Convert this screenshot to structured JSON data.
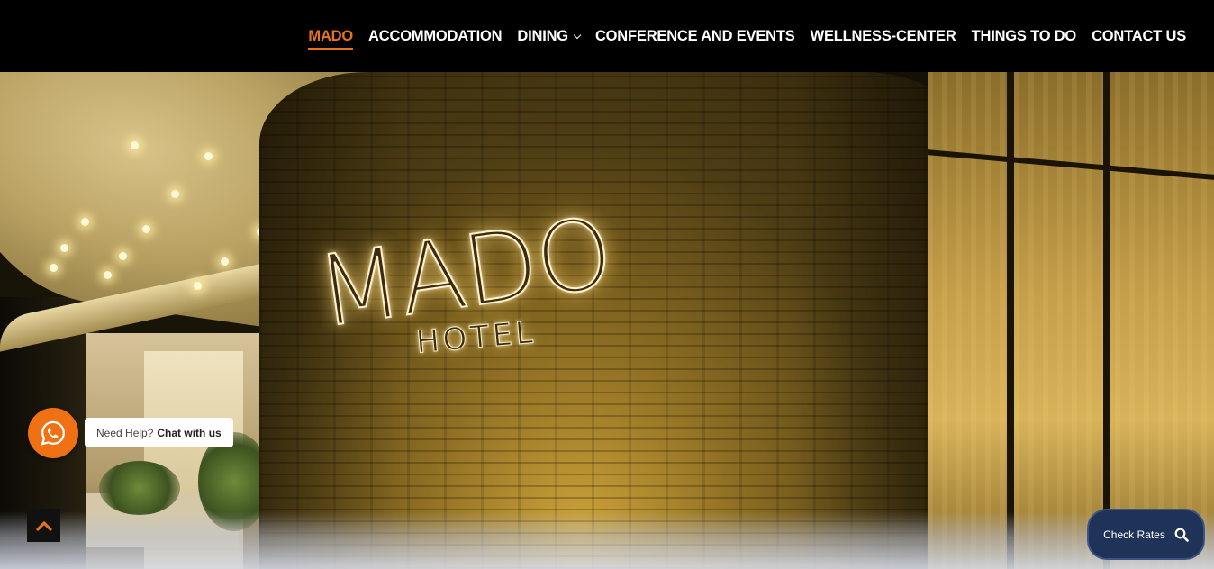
{
  "nav": {
    "items": [
      {
        "label": "MADO",
        "active": true
      },
      {
        "label": "ACCOMMODATION"
      },
      {
        "label": "DINING",
        "dropdown": true
      },
      {
        "label": "CONFERENCE AND EVENTS"
      },
      {
        "label": "WELLNESS-CENTER"
      },
      {
        "label": "THINGS TO DO"
      },
      {
        "label": "CONTACT US"
      }
    ]
  },
  "hero": {
    "sign_main": "MADO",
    "sign_sub": "HOTEL"
  },
  "chat": {
    "prefix": "Need Help?",
    "link": "Chat with us",
    "icon": "whatsapp-icon"
  },
  "back_to_top": {
    "icon": "chevron-up-icon"
  },
  "check_rates": {
    "label": "Check Rates",
    "icon": "search-icon"
  },
  "colors": {
    "accent": "#e8731c",
    "whatsapp_bg": "#f07114",
    "check_rates_bg": "#1f3358",
    "header_bg": "#000000"
  }
}
